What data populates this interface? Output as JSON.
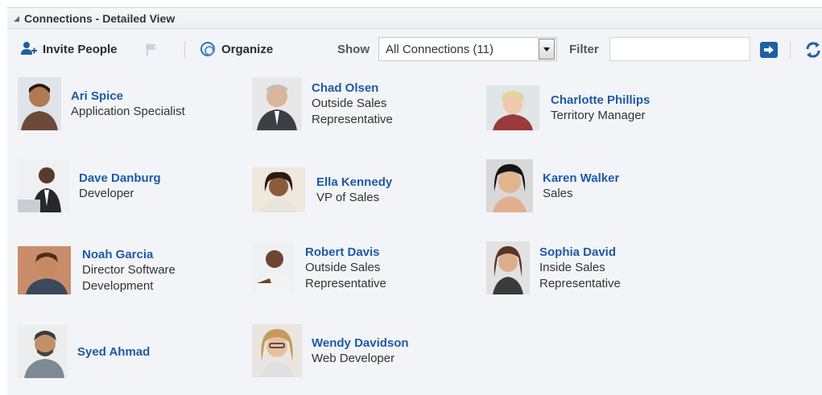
{
  "panel": {
    "title": "Connections - Detailed View"
  },
  "toolbar": {
    "invite_label": "Invite People",
    "organize_label": "Organize",
    "show_label": "Show",
    "show_value": "All Connections (11)",
    "filter_label": "Filter",
    "filter_value": "",
    "colors": {
      "accent": "#1f5fa3",
      "link": "#1f5aa6"
    }
  },
  "people": [
    {
      "name": "Ari Spice",
      "title": "Application Specialist"
    },
    {
      "name": "Chad Olsen",
      "title": "Outside Sales\nRepresentative"
    },
    {
      "name": "Charlotte Phillips",
      "title": "Territory Manager"
    },
    {
      "name": "Dave Danburg",
      "title": "Developer"
    },
    {
      "name": "Ella Kennedy",
      "title": "VP of Sales"
    },
    {
      "name": "Karen Walker",
      "title": "Sales"
    },
    {
      "name": "Noah Garcia",
      "title": "Director Software\nDevelopment"
    },
    {
      "name": "Robert Davis",
      "title": "Outside Sales\nRepresentative"
    },
    {
      "name": "Sophia David",
      "title": "Inside Sales\nRepresentative"
    },
    {
      "name": "Syed Ahmad",
      "title": ""
    },
    {
      "name": "Wendy Davidson",
      "title": "Web Developer"
    }
  ]
}
